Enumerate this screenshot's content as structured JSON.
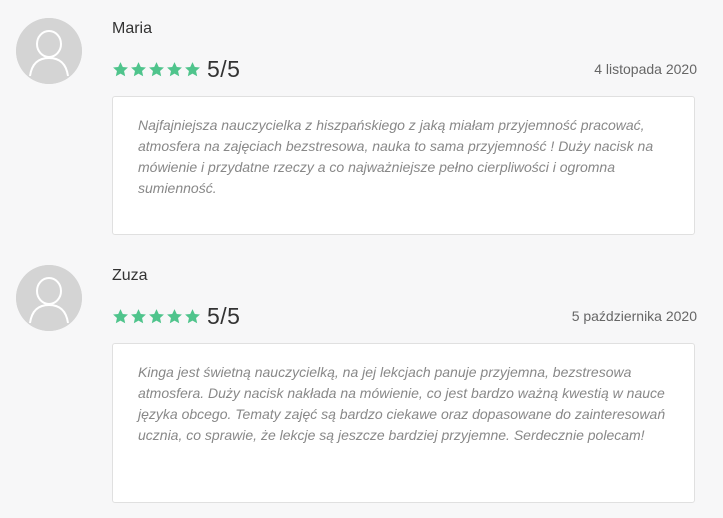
{
  "colors": {
    "star": "#4fc48c",
    "avatar_bg": "#d4d4d4"
  },
  "reviews": [
    {
      "name": "Maria",
      "stars": 5,
      "score": "5/5",
      "date": "4 listopada 2020",
      "text": "Najfajniejsza nauczycielka z hiszpańskiego z jaką miałam przyjemność pracować, atmosfera na zajęciach bezstresowa, nauka to sama przyjemność ! Duży nacisk na mówienie i przydatne rzeczy a co najważniejsze pełno cierpliwości i ogromna sumienność."
    },
    {
      "name": "Zuza",
      "stars": 5,
      "score": "5/5",
      "date": "5 października 2020",
      "text": "Kinga jest świetną nauczycielką, na jej lekcjach panuje przyjemna, bezstresowa atmosfera. Duży nacisk nakłada na mówienie, co jest bardzo ważną kwestią w nauce języka obcego. Tematy zajęć są bardzo ciekawe oraz dopasowane do zainteresowań ucznia, co sprawie, że lekcje są jeszcze bardziej przyjemne. Serdecznie polecam!"
    }
  ]
}
